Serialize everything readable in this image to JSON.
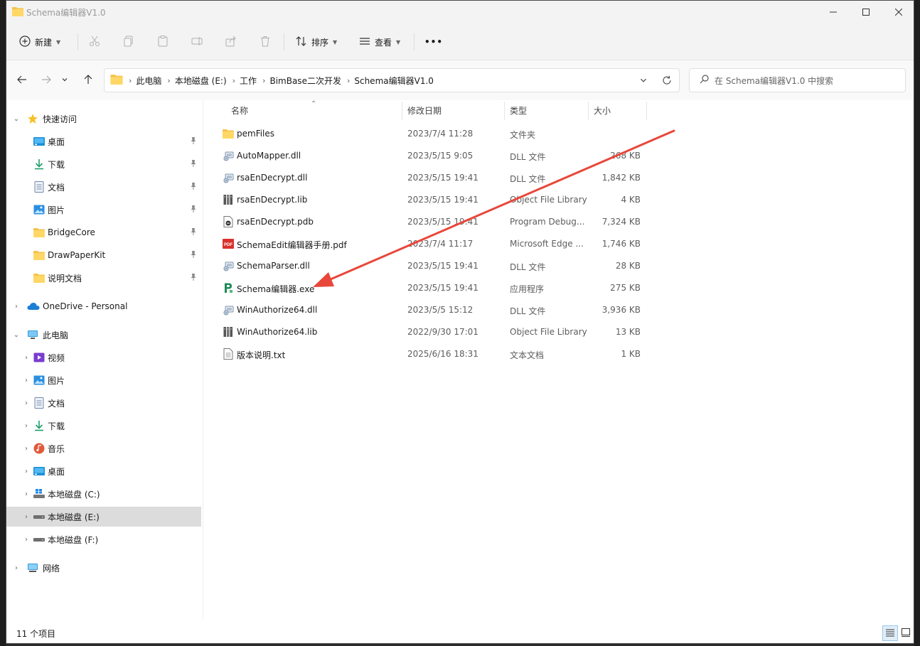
{
  "window": {
    "title": "Schema编辑器V1.0"
  },
  "toolbar": {
    "new_label": "新建",
    "sort_label": "排序",
    "view_label": "查看",
    "more_label": "•••"
  },
  "address": {
    "crumbs": [
      "此电脑",
      "本地磁盘 (E:)",
      "工作",
      "BimBase二次开发",
      "Schema编辑器V1.0"
    ],
    "search_placeholder": "在 Schema编辑器V1.0 中搜索"
  },
  "sidebar": {
    "quick_access": "快速访问",
    "quick_items": [
      {
        "label": "桌面",
        "icon": "desktop-icon"
      },
      {
        "label": "下载",
        "icon": "download-icon"
      },
      {
        "label": "文档",
        "icon": "document-icon"
      },
      {
        "label": "图片",
        "icon": "picture-icon"
      },
      {
        "label": "BridgeCore",
        "icon": "folder-icon"
      },
      {
        "label": "DrawPaperKit",
        "icon": "folder-icon"
      },
      {
        "label": "说明文档",
        "icon": "folder-icon"
      }
    ],
    "onedrive": "OneDrive - Personal",
    "this_pc": "此电脑",
    "pc_items": [
      {
        "label": "视频",
        "icon": "video-icon"
      },
      {
        "label": "图片",
        "icon": "picture-icon"
      },
      {
        "label": "文档",
        "icon": "document-icon"
      },
      {
        "label": "下载",
        "icon": "download-icon"
      },
      {
        "label": "音乐",
        "icon": "music-icon"
      },
      {
        "label": "桌面",
        "icon": "desktop-icon"
      },
      {
        "label": "本地磁盘 (C:)",
        "icon": "windows-drive-icon"
      },
      {
        "label": "本地磁盘 (E:)",
        "icon": "drive-icon"
      },
      {
        "label": "本地磁盘 (F:)",
        "icon": "drive-icon"
      }
    ],
    "network": "网络"
  },
  "columns": {
    "name": "名称",
    "date": "修改日期",
    "type": "类型",
    "size": "大小"
  },
  "files": [
    {
      "name": "pemFiles",
      "date": "2023/7/4 11:28",
      "type": "文件夹",
      "size": "",
      "icon": "folder-icon"
    },
    {
      "name": "AutoMapper.dll",
      "date": "2023/5/15 9:05",
      "type": "DLL 文件",
      "size": "268 KB",
      "icon": "dll-icon"
    },
    {
      "name": "rsaEnDecrypt.dll",
      "date": "2023/5/15 19:41",
      "type": "DLL 文件",
      "size": "1,842 KB",
      "icon": "dll-icon"
    },
    {
      "name": "rsaEnDecrypt.lib",
      "date": "2023/5/15 19:41",
      "type": "Object File Library",
      "size": "4 KB",
      "icon": "lib-icon"
    },
    {
      "name": "rsaEnDecrypt.pdb",
      "date": "2023/5/15 19:41",
      "type": "Program Debug...",
      "size": "7,324 KB",
      "icon": "pdb-icon"
    },
    {
      "name": "SchemaEdit编辑器手册.pdf",
      "date": "2023/7/4 11:17",
      "type": "Microsoft Edge ...",
      "size": "1,746 KB",
      "icon": "pdf-icon"
    },
    {
      "name": "SchemaParser.dll",
      "date": "2023/5/15 19:41",
      "type": "DLL 文件",
      "size": "28 KB",
      "icon": "dll-icon"
    },
    {
      "name": "Schema编辑器.exe",
      "date": "2023/5/15 19:41",
      "type": "应用程序",
      "size": "275 KB",
      "icon": "exe-icon"
    },
    {
      "name": "WinAuthorize64.dll",
      "date": "2023/5/5 15:12",
      "type": "DLL 文件",
      "size": "3,936 KB",
      "icon": "dll-icon"
    },
    {
      "name": "WinAuthorize64.lib",
      "date": "2022/9/30 17:01",
      "type": "Object File Library",
      "size": "13 KB",
      "icon": "lib-icon"
    },
    {
      "name": "版本说明.txt",
      "date": "2025/6/16 18:31",
      "type": "文本文档",
      "size": "1 KB",
      "icon": "text-file-icon"
    }
  ],
  "status": {
    "count": "11 个项目"
  },
  "annotation": {
    "arrow_color": "#e8473a"
  }
}
